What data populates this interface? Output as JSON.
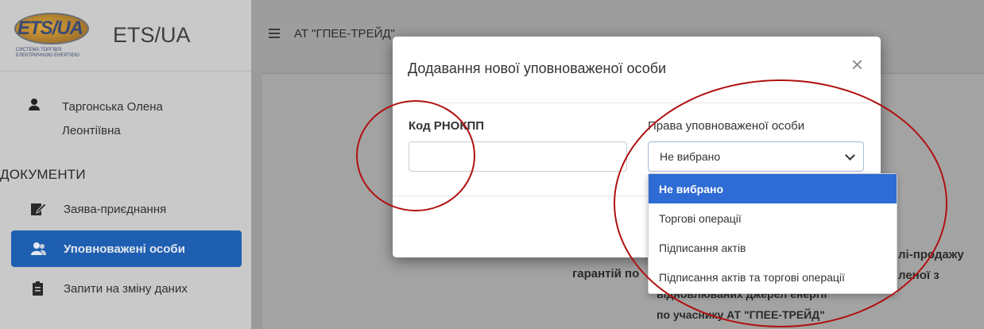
{
  "brand": {
    "logo_text": "ETS/UA",
    "logo_subtitle": "Система торгівлі електричною енергією",
    "title": "ETS/UA"
  },
  "user": {
    "name": "Таргонська Олена Леонтіївна"
  },
  "sidebar": {
    "section_title": "ДОКУМЕНТИ",
    "items": [
      {
        "label": "Заява-приєднання",
        "icon": "edit-document-icon",
        "active": false
      },
      {
        "label": "Уповноважені особи",
        "icon": "users-icon",
        "active": true
      },
      {
        "label": "Запити на зміну даних",
        "icon": "clipboard-icon",
        "active": false
      }
    ]
  },
  "topbar": {
    "company": "АТ \"ГПЕЕ-ТРЕЙД\""
  },
  "background": {
    "line1_right": "лі-продажу",
    "line2_left": "гарантій по",
    "line2_right": "леної з",
    "line3": "відновлюваних джерел енергії",
    "line4": "по учаснику АТ \"ГПЕЕ-ТРЕЙД\""
  },
  "modal": {
    "title": "Додавання нової уповноваженої особи",
    "close_label": "×",
    "rnokpp_label": "Код РНОКПП",
    "rnokpp_value": "",
    "rights_label": "Права уповноваженої особи",
    "rights_value": "Не вибрано"
  },
  "dropdown": {
    "options": [
      {
        "label": "Не вибрано",
        "selected": true
      },
      {
        "label": "Торгові операції",
        "selected": false
      },
      {
        "label": "Підписання актів",
        "selected": false
      },
      {
        "label": "Підписання актів та торгові операції",
        "selected": false
      }
    ]
  },
  "colors": {
    "accent": "#1f5fb1",
    "selected_option": "#2e6bd4",
    "annotation": "#b01010"
  }
}
